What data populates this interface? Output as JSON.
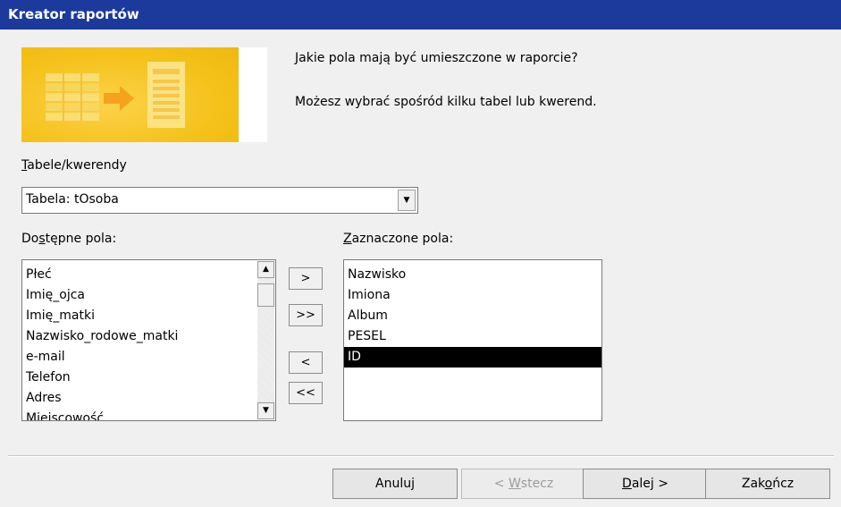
{
  "window": {
    "title": "Kreator raportów"
  },
  "prompt": {
    "line1": "Jakie pola mają być umieszczone w raporcie?",
    "line2": "Możesz wybrać spośród kilku tabel lub kwerend."
  },
  "tables": {
    "label_ak": "T",
    "label_rest": "abele/kwerendy",
    "selected": "Tabela: tOsoba"
  },
  "available": {
    "label_pre": "Do",
    "label_ak": "s",
    "label_post": "tępne pola:",
    "items": [
      "Płeć",
      "Imię_ojca",
      "Imię_matki",
      "Nazwisko_rodowe_matki",
      "e-mail",
      "Telefon",
      "Adres",
      "Miejscowość"
    ]
  },
  "selected_fields": {
    "label_ak": "Z",
    "label_rest": "aznaczone pola:",
    "items": [
      "Nazwisko",
      "Imiona",
      "Album",
      "PESEL",
      "ID"
    ],
    "highlighted": "ID"
  },
  "move_buttons": {
    "add_one": ">",
    "add_all": ">>",
    "remove_one": "<",
    "remove_all": "<<"
  },
  "buttons": {
    "cancel": "Anuluj",
    "back_pre": "< ",
    "back_ak": "W",
    "back_post": "stecz",
    "next_ak": "D",
    "next_post": "alej >",
    "finish_pre": "Zak",
    "finish_ak": "o",
    "finish_post": "ńcz"
  },
  "colors": {
    "titlebar": "#1c3a9c",
    "illustration": "#f5c21b",
    "selection": "#000000"
  }
}
